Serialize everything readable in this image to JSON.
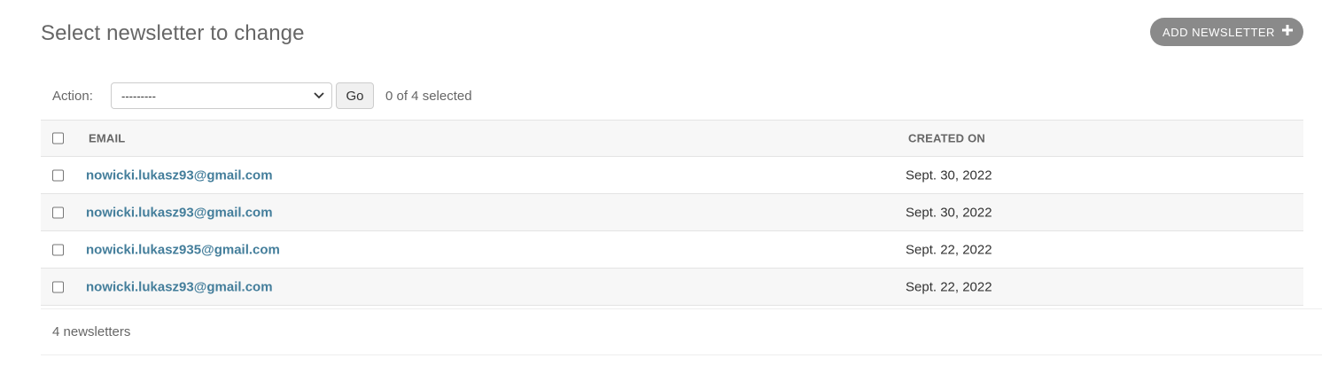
{
  "page": {
    "title": "Select newsletter to change"
  },
  "add_button": {
    "label": "ADD NEWSLETTER",
    "icon": "plus-icon",
    "color": "#8a8a8a"
  },
  "actions": {
    "label": "Action:",
    "selected": "---------",
    "go_label": "Go",
    "counter": "0 of 4 selected"
  },
  "table": {
    "columns": [
      "EMAIL",
      "CREATED ON"
    ],
    "rows": [
      {
        "email": "nowicki.lukasz93@gmail.com",
        "created_on": "Sept. 30, 2022"
      },
      {
        "email": "nowicki.lukasz93@gmail.com",
        "created_on": "Sept. 30, 2022"
      },
      {
        "email": "nowicki.lukasz935@gmail.com",
        "created_on": "Sept. 22, 2022"
      },
      {
        "email": "nowicki.lukasz93@gmail.com",
        "created_on": "Sept. 22, 2022"
      }
    ],
    "link_color": "#447e9b"
  },
  "paginator": {
    "text": "4 newsletters"
  }
}
